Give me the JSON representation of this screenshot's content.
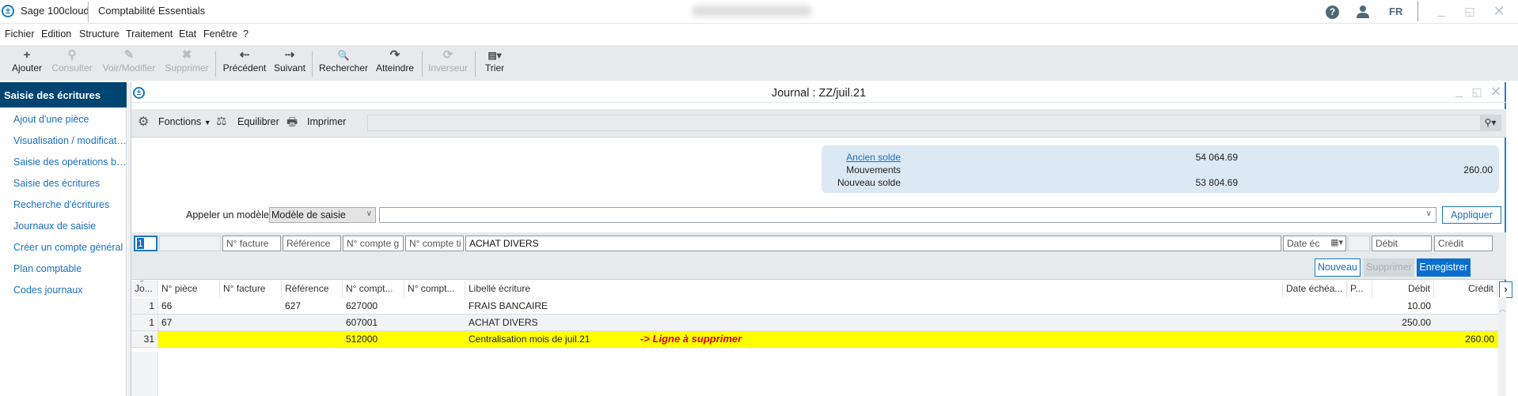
{
  "app": {
    "brand": "Sage 100cloud",
    "product": "Comptabilité Essentials",
    "lang": "FR",
    "icons": {
      "logo": "sage-logo-icon",
      "help": "help-icon",
      "user": "user-icon",
      "minimize": "minimize-icon",
      "restore": "restore-icon",
      "close": "close-icon"
    }
  },
  "menu": [
    "Fichier",
    "Edition",
    "Structure",
    "Traitement",
    "Etat",
    "Fenêtre",
    "?"
  ],
  "toolbar": [
    {
      "label": "Ajouter",
      "icon": "+",
      "enabled": true
    },
    {
      "label": "Consulter",
      "icon": "⚲",
      "enabled": false
    },
    {
      "label": "Voir/Modifier",
      "icon": "✎",
      "enabled": false
    },
    {
      "label": "Supprimer",
      "icon": "✖",
      "enabled": false
    },
    {
      "label": "Précédent",
      "icon": "⇠",
      "enabled": true
    },
    {
      "label": "Suivant",
      "icon": "⇢",
      "enabled": true
    },
    {
      "label": "Rechercher",
      "icon": "🔍",
      "enabled": true
    },
    {
      "label": "Atteindre",
      "icon": "↷",
      "enabled": true
    },
    {
      "label": "Inverseur",
      "icon": "⟳",
      "enabled": false
    },
    {
      "label": "Trier",
      "icon": "▤▾",
      "enabled": true
    }
  ],
  "sidebar": {
    "header": "Saisie des écritures",
    "items": [
      "Ajout d'une pièce",
      "Visualisation / modificati...",
      "Saisie des opérations ban...",
      "Saisie des écritures",
      "Recherche d'écritures",
      "Journaux de saisie",
      "Créer un compte général",
      "Plan comptable",
      "Codes journaux"
    ]
  },
  "window": {
    "title": "Journal : ZZ/juil.21",
    "tools": {
      "fonctions": "Fonctions",
      "equilibrer": "Equilibrer",
      "imprimer": "Imprimer"
    },
    "search_value": ""
  },
  "summary": {
    "ancien_solde_label": "Ancien solde",
    "ancien_solde": "54 064.69",
    "mouvements_label": "Mouvements",
    "mouvements": "260.00",
    "nouveau_solde_label": "Nouveau solde",
    "nouveau_solde": "53 804.69"
  },
  "model": {
    "label": "Appeler un modèle",
    "select_value": "Modèle de saisie",
    "combo_value": "",
    "apply": "Appliquer"
  },
  "entry": {
    "jour": "1",
    "piece": "",
    "facture_placeholder": "N° facture",
    "reference_placeholder": "Référence",
    "compte_g_placeholder": "N° compte g",
    "compte_t_placeholder": "N° compte ti",
    "libelle": "ACHAT DIVERS",
    "date_placeholder": "Date éc",
    "debit_placeholder": "Débit",
    "credit_placeholder": "Crédit"
  },
  "actions": {
    "nouveau": "Nouveau",
    "supprimer": "Supprimer",
    "enregistrer": "Enregistrer"
  },
  "grid": {
    "headers": [
      "Jo...",
      "N° pièce",
      "N° facture",
      "Référence",
      "N° compt...",
      "N° compt...",
      "Libellé écriture",
      "Date échéa...",
      "P...",
      "Débit",
      "Crédit"
    ],
    "rows": [
      {
        "jour": "1",
        "piece": "66",
        "facture": "",
        "reference": "627",
        "compte_g": "627000",
        "compte_t": "",
        "libelle": "FRAIS BANCAIRE",
        "echeance": "",
        "p": "",
        "debit": "10.00",
        "credit": "",
        "highlight": false
      },
      {
        "jour": "1",
        "piece": "67",
        "facture": "",
        "reference": "",
        "compte_g": "607001",
        "compte_t": "",
        "libelle": "ACHAT DIVERS",
        "echeance": "",
        "p": "",
        "debit": "250.00",
        "credit": "",
        "highlight": false
      },
      {
        "jour": "31",
        "piece": "",
        "facture": "",
        "reference": "",
        "compte_g": "512000",
        "compte_t": "",
        "libelle": "Centralisation mois de juil.21",
        "echeance": "",
        "p": "",
        "debit": "",
        "credit": "260.00",
        "highlight": true
      }
    ],
    "annotation": "->  Ligne à supprimer",
    "highlight_color": "#ffff00",
    "annotation_color": "#e00000"
  }
}
